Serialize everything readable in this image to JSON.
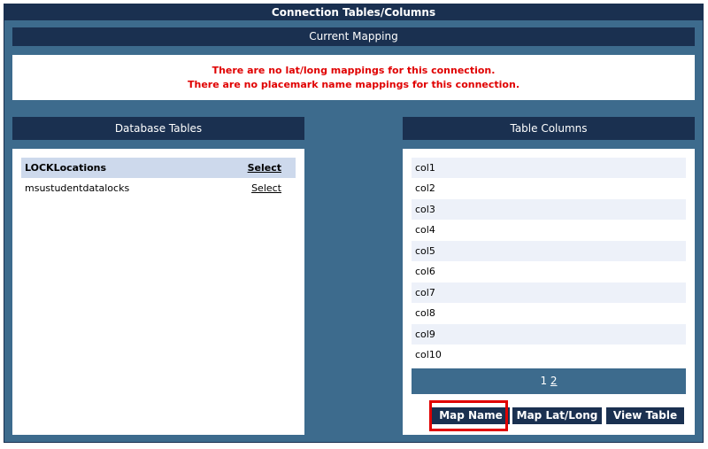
{
  "window": {
    "title": "Connection Tables/Columns"
  },
  "current_mapping": {
    "title": "Current Mapping",
    "messages": [
      "There are no lat/long mappings for this connection.",
      "There are no placemark name mappings for this connection."
    ]
  },
  "database_tables": {
    "title": "Database Tables",
    "rows": [
      {
        "name": "LOCKLocations",
        "action": "Select",
        "selected": true
      },
      {
        "name": "msustudentdatalocks",
        "action": "Select",
        "selected": false
      }
    ]
  },
  "table_columns": {
    "title": "Table Columns",
    "columns": [
      "col1",
      "col2",
      "col3",
      "col4",
      "col5",
      "col6",
      "col7",
      "col8",
      "col9",
      "col10"
    ],
    "pager": {
      "page1": "1",
      "page2": "2",
      "current_page": "2"
    }
  },
  "buttons": {
    "map_name": "Map Name",
    "map_latlong": "Map Lat/Long",
    "view_table": "View Table"
  },
  "colors": {
    "frame": "#3d6b8d",
    "header": "#1a3050",
    "selected_row": "#cdd9ec",
    "alt_row": "#edf1f9",
    "error_text": "#e00000",
    "highlight_border": "#e00000"
  }
}
